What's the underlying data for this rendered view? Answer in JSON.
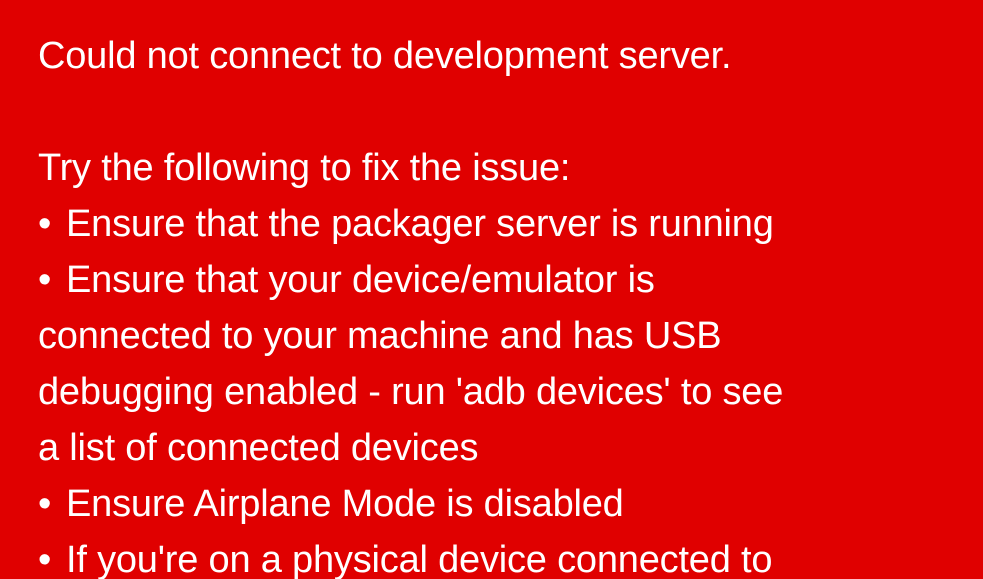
{
  "error": {
    "title": "Could not connect to development server.",
    "subtitle": "Try the following to fix the issue:",
    "bullet_char": "•",
    "items": [
      {
        "lines": [
          "Ensure that the packager server is running"
        ]
      },
      {
        "lines": [
          "Ensure that your device/emulator is",
          "connected to your machine and has USB",
          "debugging enabled - run 'adb devices' to see",
          "a list of connected devices"
        ]
      },
      {
        "lines": [
          "Ensure Airplane Mode is disabled"
        ]
      },
      {
        "lines": [
          "If you're on a physical device connected to"
        ]
      }
    ]
  },
  "colors": {
    "background": "#e00000",
    "text": "#ffffff"
  }
}
